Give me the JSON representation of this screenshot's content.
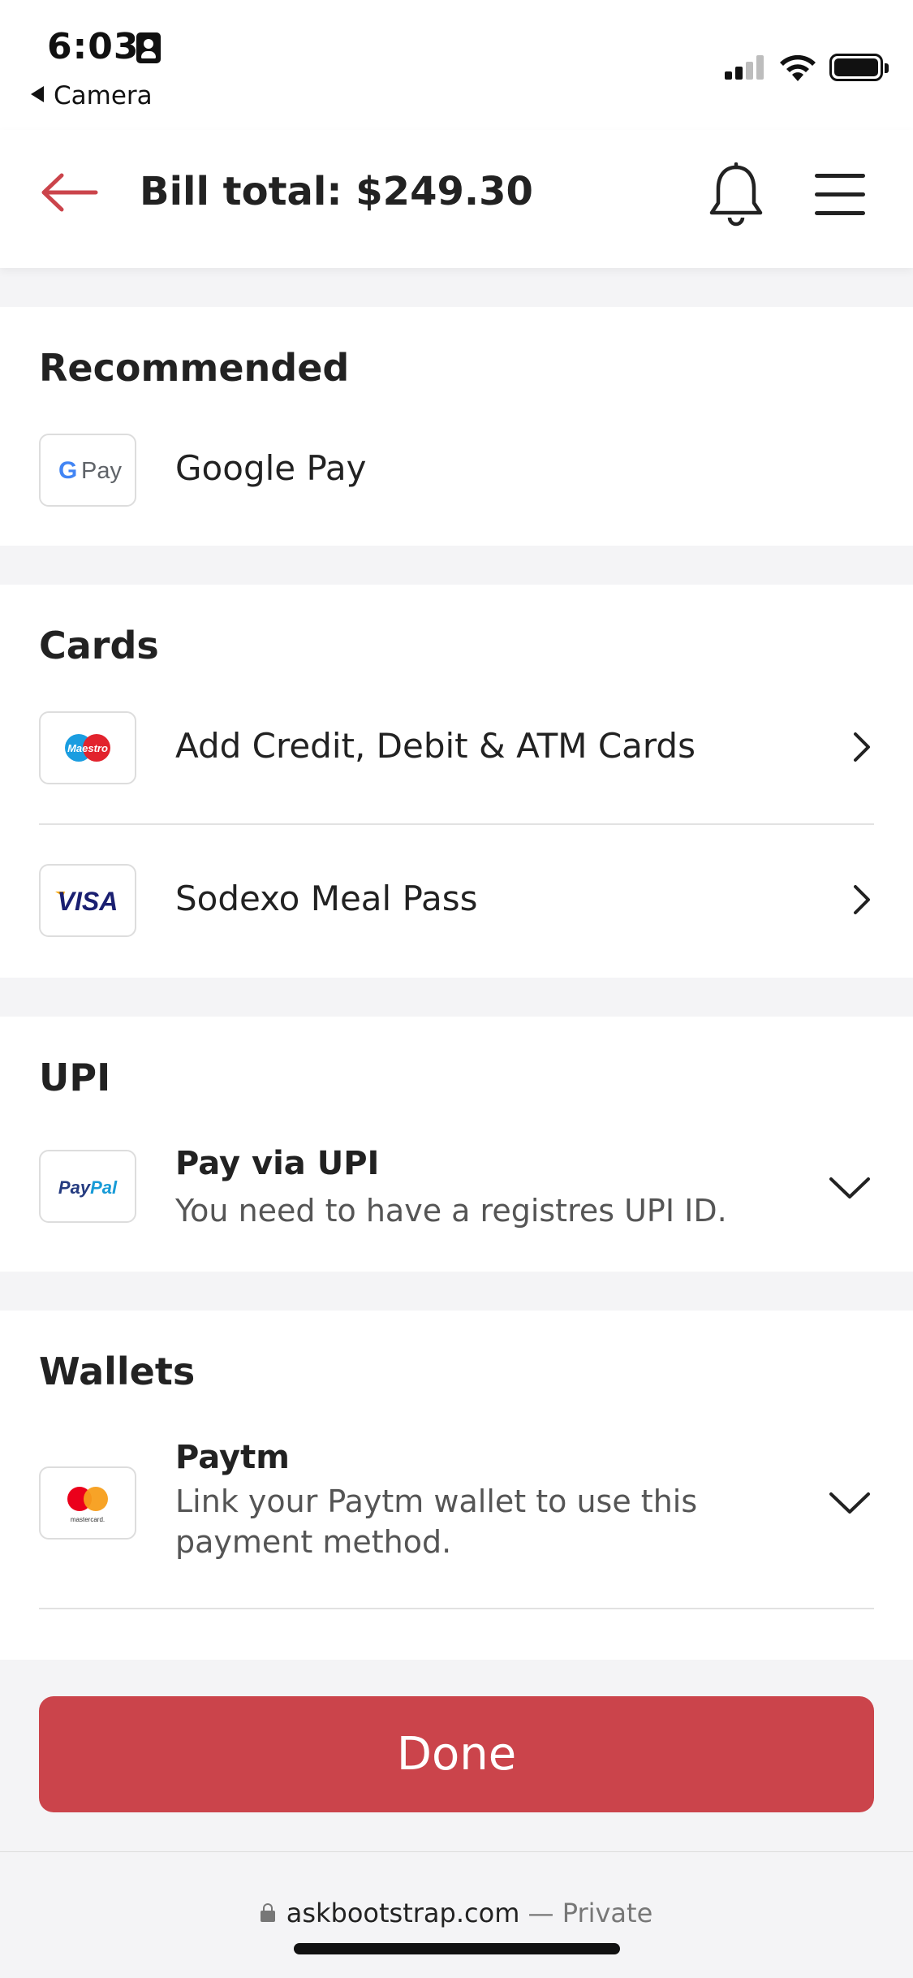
{
  "status_bar": {
    "time": "6:03",
    "back_app": "Camera"
  },
  "header": {
    "title": "Bill total: $249.30",
    "icons": [
      "back-arrow-icon",
      "bell-icon",
      "hamburger-menu-icon"
    ],
    "accent_color": "#cb444b"
  },
  "sections": {
    "recommended": {
      "title": "Recommended",
      "items": [
        {
          "label": "Google Pay",
          "logo": "G Pay"
        }
      ]
    },
    "cards": {
      "title": "Cards",
      "items": [
        {
          "label": "Add Credit, Debit & ATM Cards",
          "logo": "Maestro"
        },
        {
          "label": "Sodexo Meal Pass",
          "logo": "VISA"
        }
      ]
    },
    "upi": {
      "title": "UPI",
      "items": [
        {
          "title": "Pay via UPI",
          "subtitle": "You need to have a registres UPI ID.",
          "logo": "PayPal"
        }
      ]
    },
    "wallets": {
      "title": "Wallets",
      "items": [
        {
          "title": "Paytm",
          "subtitle": "Link your Paytm wallet to use this payment method.",
          "logo": "mastercard"
        }
      ]
    }
  },
  "done_button": {
    "label": "Done"
  },
  "browser": {
    "domain": "askbootstrap.com",
    "suffix": "— Private"
  }
}
